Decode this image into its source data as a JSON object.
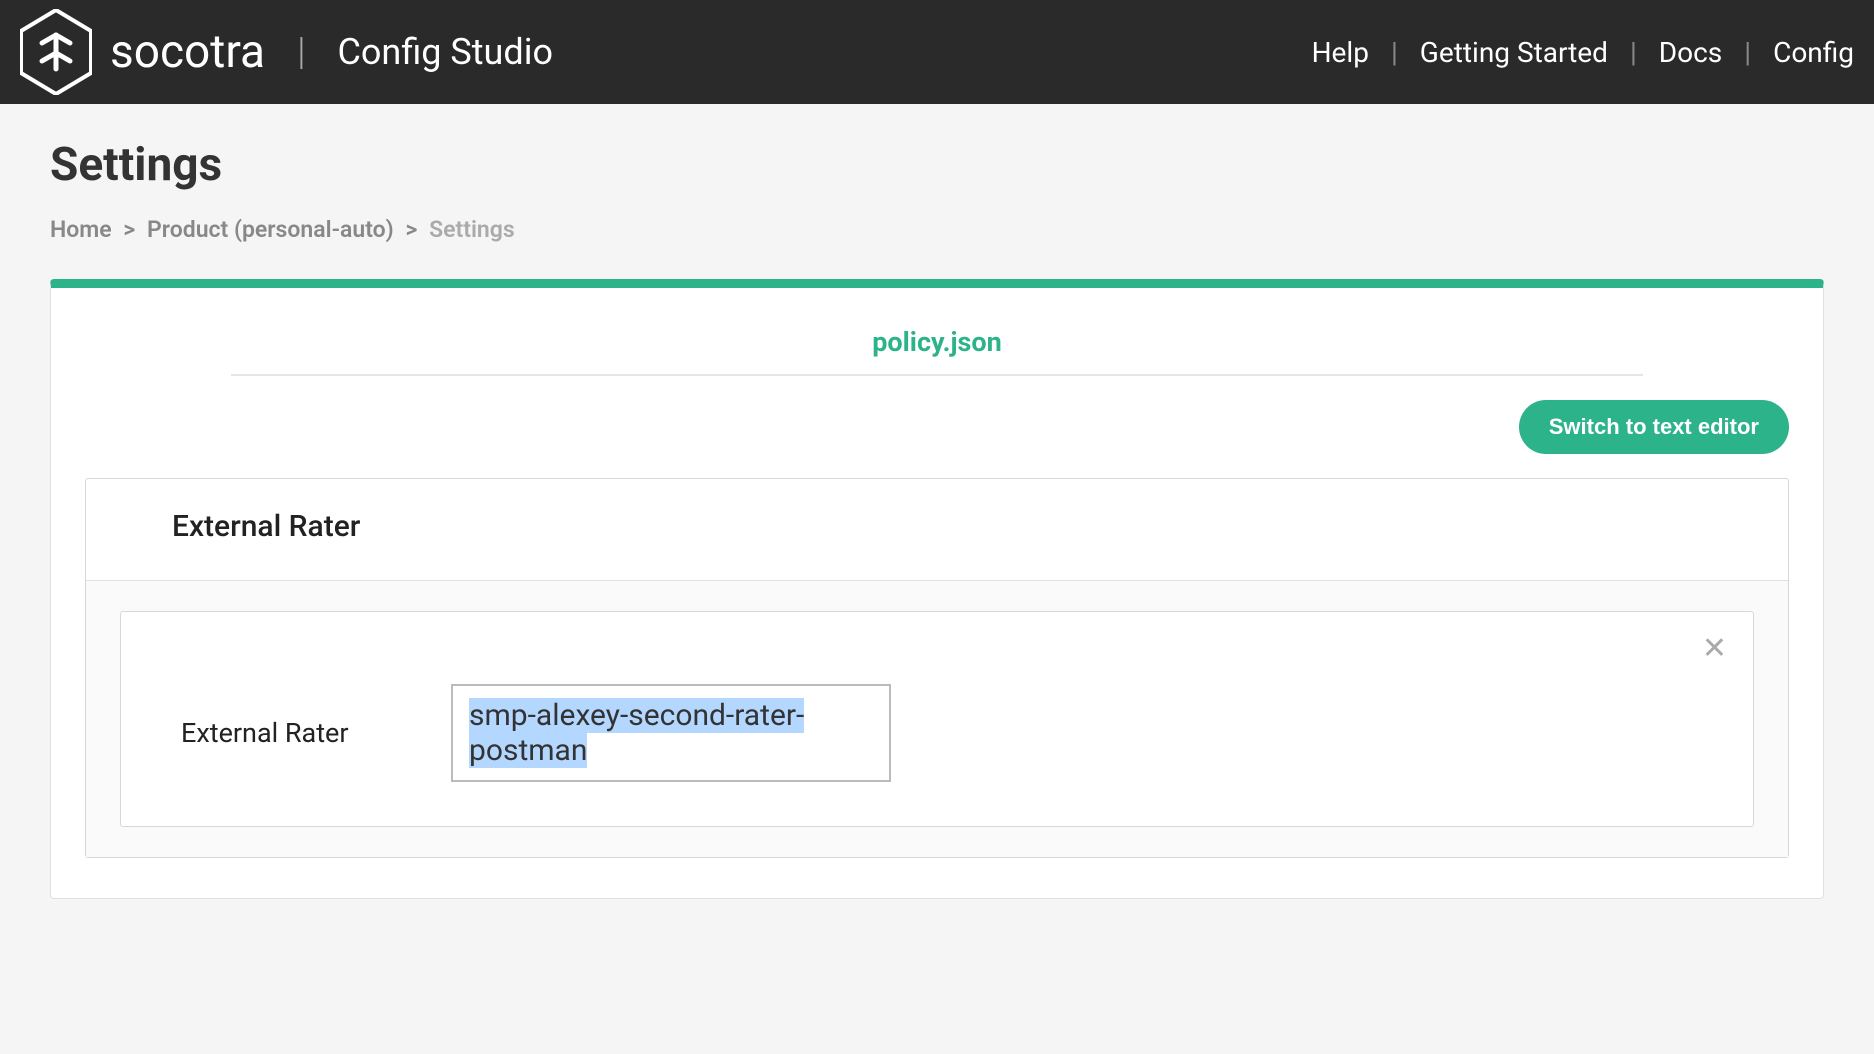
{
  "header": {
    "brand": "socotra",
    "app_name": "Config Studio",
    "nav": {
      "help": "Help",
      "getting_started": "Getting Started",
      "docs": "Docs",
      "config": "Config"
    }
  },
  "page": {
    "title": "Settings",
    "breadcrumb": {
      "home": "Home",
      "product": "Product (personal-auto)",
      "current": "Settings"
    }
  },
  "card": {
    "tab": "policy.json",
    "switch_button": "Switch to text editor",
    "section": {
      "title": "External Rater",
      "field": {
        "label": "External Rater",
        "value": "smp-alexey-second-rater-postman"
      }
    }
  }
}
